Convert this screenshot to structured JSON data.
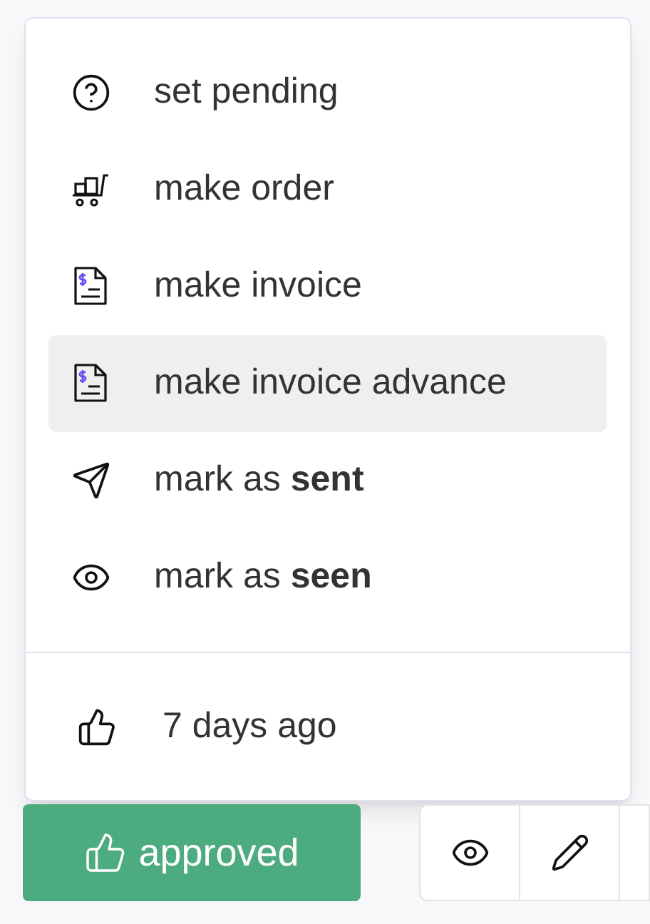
{
  "menu": {
    "items": [
      {
        "kind": "help",
        "label": "set pending",
        "selected": false
      },
      {
        "kind": "cart",
        "label": "make order",
        "selected": false
      },
      {
        "kind": "invoice",
        "label": "make invoice",
        "selected": false
      },
      {
        "kind": "invoice",
        "label": "make invoice advance",
        "selected": true
      },
      {
        "kind": "send",
        "label": "mark as **sent**",
        "selected": false
      },
      {
        "kind": "eye",
        "label": "mark as **seen**",
        "selected": false
      }
    ],
    "footer": {
      "label": "7 days ago"
    }
  },
  "status_button": {
    "label": "approved"
  }
}
